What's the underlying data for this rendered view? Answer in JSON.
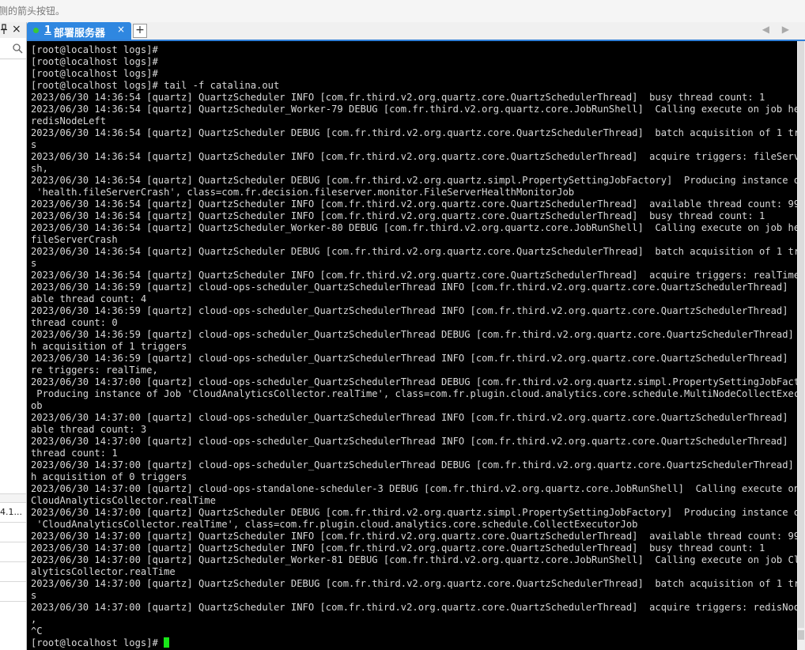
{
  "hint_bar": {
    "text": "侧的箭头按钮。"
  },
  "left_panel": {
    "pin_icon": "pin-icon",
    "close_label": "×",
    "list_rows": [
      "4.1...",
      "",
      "",
      "",
      ""
    ]
  },
  "tabs": [
    {
      "number": "1",
      "label": "部署服务器",
      "active": true,
      "status_color": "#38c838"
    }
  ],
  "tab_close": "×",
  "add_tab": "+",
  "nav_arrows": "◀ ▶",
  "terminal": {
    "lines": [
      "[root@localhost logs]#",
      "[root@localhost logs]#",
      "[root@localhost logs]#",
      "[root@localhost logs]# tail -f catalina.out",
      "2023/06/30 14:36:54 [quartz] QuartzScheduler INFO [com.fr.third.v2.org.quartz.core.QuartzSchedulerThread]  busy thread count: 1",
      "2023/06/30 14:36:54 [quartz] QuartzScheduler_Worker-79 DEBUG [com.fr.third.v2.org.quartz.core.JobRunShell]  Calling execute on job health.",
      "redisNodeLeft",
      "2023/06/30 14:36:54 [quartz] QuartzScheduler DEBUG [com.fr.third.v2.org.quartz.core.QuartzSchedulerThread]  batch acquisition of 1 trigger",
      "s",
      "2023/06/30 14:36:54 [quartz] QuartzScheduler INFO [com.fr.third.v2.org.quartz.core.QuartzSchedulerThread]  acquire triggers: fileServerCra",
      "sh,",
      "2023/06/30 14:36:54 [quartz] QuartzScheduler DEBUG [com.fr.third.v2.org.quartz.simpl.PropertySettingJobFactory]  Producing instance of Job",
      " 'health.fileServerCrash', class=com.fr.decision.fileserver.monitor.FileServerHealthMonitorJob",
      "2023/06/30 14:36:54 [quartz] QuartzScheduler INFO [com.fr.third.v2.org.quartz.core.QuartzSchedulerThread]  available thread count: 99",
      "2023/06/30 14:36:54 [quartz] QuartzScheduler INFO [com.fr.third.v2.org.quartz.core.QuartzSchedulerThread]  busy thread count: 1",
      "2023/06/30 14:36:54 [quartz] QuartzScheduler_Worker-80 DEBUG [com.fr.third.v2.org.quartz.core.JobRunShell]  Calling execute on job health.",
      "fileServerCrash",
      "2023/06/30 14:36:54 [quartz] QuartzScheduler DEBUG [com.fr.third.v2.org.quartz.core.QuartzSchedulerThread]  batch acquisition of 1 trigger",
      "s",
      "2023/06/30 14:36:54 [quartz] QuartzScheduler INFO [com.fr.third.v2.org.quartz.core.QuartzSchedulerThread]  acquire triggers: realTime,",
      "2023/06/30 14:36:59 [quartz] cloud-ops-scheduler_QuartzSchedulerThread INFO [com.fr.third.v2.org.quartz.core.QuartzSchedulerThread]  avail",
      "able thread count: 4",
      "2023/06/30 14:36:59 [quartz] cloud-ops-scheduler_QuartzSchedulerThread INFO [com.fr.third.v2.org.quartz.core.QuartzSchedulerThread]  busy",
      "thread count: 0",
      "2023/06/30 14:36:59 [quartz] cloud-ops-scheduler_QuartzSchedulerThread DEBUG [com.fr.third.v2.org.quartz.core.QuartzSchedulerThread]  batc",
      "h acquisition of 1 triggers",
      "2023/06/30 14:36:59 [quartz] cloud-ops-scheduler_QuartzSchedulerThread INFO [com.fr.third.v2.org.quartz.core.QuartzSchedulerThread]  acqui",
      "re triggers: realTime,",
      "2023/06/30 14:37:00 [quartz] cloud-ops-scheduler_QuartzSchedulerThread DEBUG [com.fr.third.v2.org.quartz.simpl.PropertySettingJobFactory]",
      " Producing instance of Job 'CloudAnalyticsCollector.realTime', class=com.fr.plugin.cloud.analytics.core.schedule.MultiNodeCollectExecutorJ",
      "ob",
      "2023/06/30 14:37:00 [quartz] cloud-ops-scheduler_QuartzSchedulerThread INFO [com.fr.third.v2.org.quartz.core.QuartzSchedulerThread]  avail",
      "able thread count: 3",
      "2023/06/30 14:37:00 [quartz] cloud-ops-scheduler_QuartzSchedulerThread INFO [com.fr.third.v2.org.quartz.core.QuartzSchedulerThread]  busy",
      "thread count: 1",
      "2023/06/30 14:37:00 [quartz] cloud-ops-scheduler_QuartzSchedulerThread DEBUG [com.fr.third.v2.org.quartz.core.QuartzSchedulerThread]  batc",
      "h acquisition of 0 triggers",
      "2023/06/30 14:37:00 [quartz] cloud-ops-standalone-scheduler-3 DEBUG [com.fr.third.v2.org.quartz.core.JobRunShell]  Calling execute on job",
      "CloudAnalyticsCollector.realTime",
      "2023/06/30 14:37:00 [quartz] QuartzScheduler DEBUG [com.fr.third.v2.org.quartz.simpl.PropertySettingJobFactory]  Producing instance of Job",
      " 'CloudAnalyticsCollector.realTime', class=com.fr.plugin.cloud.analytics.core.schedule.CollectExecutorJob",
      "2023/06/30 14:37:00 [quartz] QuartzScheduler INFO [com.fr.third.v2.org.quartz.core.QuartzSchedulerThread]  available thread count: 99",
      "2023/06/30 14:37:00 [quartz] QuartzScheduler INFO [com.fr.third.v2.org.quartz.core.QuartzSchedulerThread]  busy thread count: 1",
      "2023/06/30 14:37:00 [quartz] QuartzScheduler_Worker-81 DEBUG [com.fr.third.v2.org.quartz.core.JobRunShell]  Calling execute on job CloudAn",
      "alyticsCollector.realTime",
      "2023/06/30 14:37:00 [quartz] QuartzScheduler DEBUG [com.fr.third.v2.org.quartz.core.QuartzSchedulerThread]  batch acquisition of 1 trigger",
      "s",
      "2023/06/30 14:37:00 [quartz] QuartzScheduler INFO [com.fr.third.v2.org.quartz.core.QuartzSchedulerThread]  acquire triggers: redisNodeLeft",
      ",",
      "^C"
    ],
    "prompt": "[root@localhost logs]# ",
    "cursor_color": "#19e619"
  },
  "colors": {
    "tab_active": "#2f87e0",
    "terminal_bg": "#000000",
    "terminal_fg": "#d8d8d8"
  }
}
